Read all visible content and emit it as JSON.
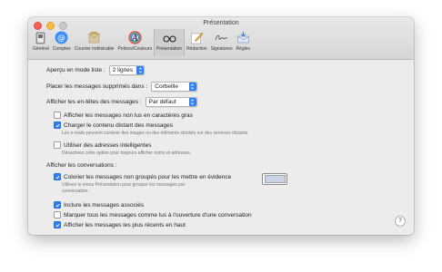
{
  "window": {
    "title": "Présentation"
  },
  "toolbar": {
    "items": [
      {
        "label": "Général",
        "icon": "general-switch-icon"
      },
      {
        "label": "Comptes",
        "icon": "at-sign-icon"
      },
      {
        "label": "Courrier indésirable",
        "icon": "junk-mail-icon"
      },
      {
        "label": "Polices/Couleurs",
        "icon": "fonts-colors-icon"
      },
      {
        "label": "Présentation",
        "icon": "glasses-icon",
        "selected": true
      },
      {
        "label": "Rédaction",
        "icon": "compose-pencil-icon"
      },
      {
        "label": "Signatures",
        "icon": "signature-icon"
      },
      {
        "label": "Règles",
        "icon": "rules-envelope-icon"
      }
    ]
  },
  "settings": {
    "list_preview_label": "Aperçu en mode liste :",
    "list_preview_value": "2 lignes",
    "deleted_label": "Placer les messages supprimés dans :",
    "deleted_value": "Corbeille",
    "headers_label": "Afficher les en-têtes des messages :",
    "headers_value": "Par défaut",
    "unread_bold": "Afficher les messages non lus en caractères gras",
    "load_remote": "Charger le contenu distant des messages",
    "load_remote_desc": "Les e-mails peuvent contenir des images ou des éléments stockés sur des serveurs distants.",
    "smart_addresses": "Utiliser des adresses intelligentes",
    "smart_addresses_desc": "Désactivez cette option pour toujours afficher noms et adresses.",
    "conversations_header": "Afficher les conversations :",
    "color_ungrouped": "Colorier les messages non groupés pour les mettre en évidence",
    "color_ungrouped_desc_1": "Utilisez le menu Présentation pour grouper les messages par",
    "color_ungrouped_desc_2": "conversation.",
    "include_related": "Inclure les messages associés",
    "mark_read": "Marquer tous les messages comme lus à l'ouverture d'une conversation",
    "recent_top": "Afficher les messages les plus récents en haut",
    "help": "?"
  },
  "colors": {
    "accent": "#2f7ef6",
    "highlight_swatch": "#c9d3e3"
  }
}
